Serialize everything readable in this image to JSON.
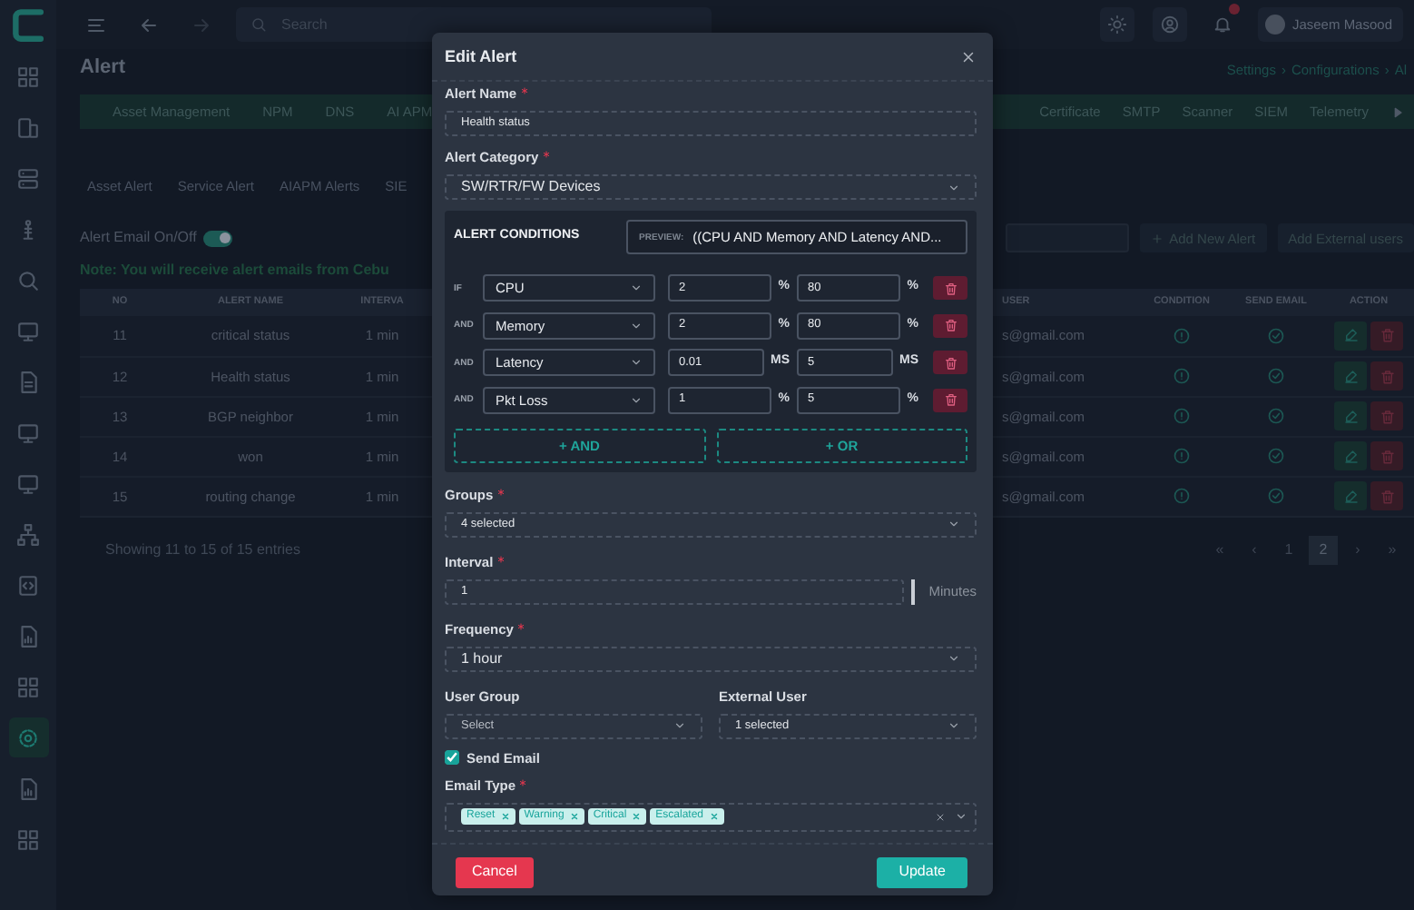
{
  "sidebar": {
    "items": [
      {
        "selected": false
      },
      {
        "selected": false
      },
      {
        "selected": false
      },
      {
        "selected": false
      },
      {
        "selected": false
      },
      {
        "selected": false
      },
      {
        "selected": false
      },
      {
        "selected": false
      },
      {
        "selected": false
      },
      {
        "selected": false
      },
      {
        "selected": false
      },
      {
        "selected": false
      },
      {
        "selected": false
      },
      {
        "selected": true
      },
      {
        "selected": false
      },
      {
        "selected": false
      }
    ]
  },
  "topbar": {
    "search": {
      "placeholder": "Search"
    },
    "user_name": "Jaseem Masood"
  },
  "page": {
    "title": "Alert",
    "breadcrumb": [
      {
        "label": "Settings",
        "separator": "›"
      },
      {
        "label": "Configurations",
        "separator": "›"
      },
      {
        "label": "Al"
      }
    ]
  },
  "tabs": [
    {
      "label": "Asset Management"
    },
    {
      "label": "NPM"
    },
    {
      "label": "DNS"
    },
    {
      "label": "AI APM"
    },
    {
      "label": "Certificate"
    },
    {
      "label": "SMTP"
    },
    {
      "label": "Scanner"
    },
    {
      "label": "SIEM"
    },
    {
      "label": "Telemetry"
    }
  ],
  "subtabs": [
    {
      "label": "Asset Alert"
    },
    {
      "label": "Service Alert"
    },
    {
      "label": "AIAPM Alerts"
    },
    {
      "label": "SIE"
    }
  ],
  "email_toggle": {
    "label": "Alert Email On/Off",
    "on": true
  },
  "actions": [
    "Add New Alert",
    "Add External users"
  ],
  "note": "Note: You will receive alert emails from Cebu",
  "table": {
    "columns": [
      "NO",
      "ALERT NAME",
      "INTERVA",
      "USER",
      "CONDITION",
      "SEND EMAIL",
      "ACTION"
    ],
    "rows": [
      {
        "no": "11",
        "alert_name": "critical status",
        "interval": "1 min",
        "user": "s@gmail.com"
      },
      {
        "no": "12",
        "alert_name": "Health status",
        "interval": "1 min",
        "user": "s@gmail.com"
      },
      {
        "no": "13",
        "alert_name": "BGP neighbor",
        "interval": "1 min",
        "user": "s@gmail.com"
      },
      {
        "no": "14",
        "alert_name": "won",
        "interval": "1 min",
        "user": "s@gmail.com"
      },
      {
        "no": "15",
        "alert_name": "routing change",
        "interval": "1 min",
        "user": "s@gmail.com"
      }
    ]
  },
  "table_info": "Showing 11 to 15 of 15 entries",
  "pagination": {
    "first": "«",
    "prev": "‹",
    "pages": [
      {
        "label": "1",
        "selected": false
      },
      {
        "label": "2",
        "selected": true
      }
    ],
    "next": "›",
    "last": "»"
  },
  "modal": {
    "title": "Edit Alert",
    "alert_name": {
      "label": "Alert Name",
      "required": true,
      "value": "Health status"
    },
    "alert_category": {
      "label": "Alert Category",
      "required": true,
      "value": "SW/RTR/FW Devices"
    },
    "conditions": {
      "title": "ALERT CONDITIONS",
      "preview_label": "PREVIEW:",
      "preview": "((CPU AND Memory AND Latency AND...",
      "rows": [
        {
          "connector": "IF",
          "metric": "CPU",
          "min": "2",
          "min_unit": "%",
          "max": "80",
          "max_unit": "%"
        },
        {
          "connector": "AND",
          "metric": "Memory",
          "min": "2",
          "min_unit": "%",
          "max": "80",
          "max_unit": "%"
        },
        {
          "connector": "AND",
          "metric": "Latency",
          "min": "0.01",
          "min_unit": "MS",
          "max": "5",
          "max_unit": "MS"
        },
        {
          "connector": "AND",
          "metric": "Pkt Loss",
          "min": "1",
          "min_unit": "%",
          "max": "5",
          "max_unit": "%"
        }
      ],
      "add_buttons": [
        "+ AND",
        "+ OR"
      ]
    },
    "groups": {
      "label": "Groups",
      "required": true,
      "value": "4 selected"
    },
    "interval": {
      "label": "Interval",
      "required": true,
      "value": "1",
      "unit": "Minutes"
    },
    "frequency": {
      "label": "Frequency",
      "required": true,
      "value": "1 hour"
    },
    "user_group": {
      "label": "User Group",
      "required": false,
      "placeholder": "Select"
    },
    "external_user": {
      "label": "External User",
      "required": false,
      "value": "1 selected"
    },
    "send_email": {
      "label": "Send Email",
      "checked": true
    },
    "email_type": {
      "label": "Email Type",
      "required": true,
      "tags": [
        "Reset",
        "Warning",
        "Critical",
        "Escalated"
      ]
    },
    "buttons": {
      "cancel": "Cancel",
      "update": "Update"
    }
  }
}
